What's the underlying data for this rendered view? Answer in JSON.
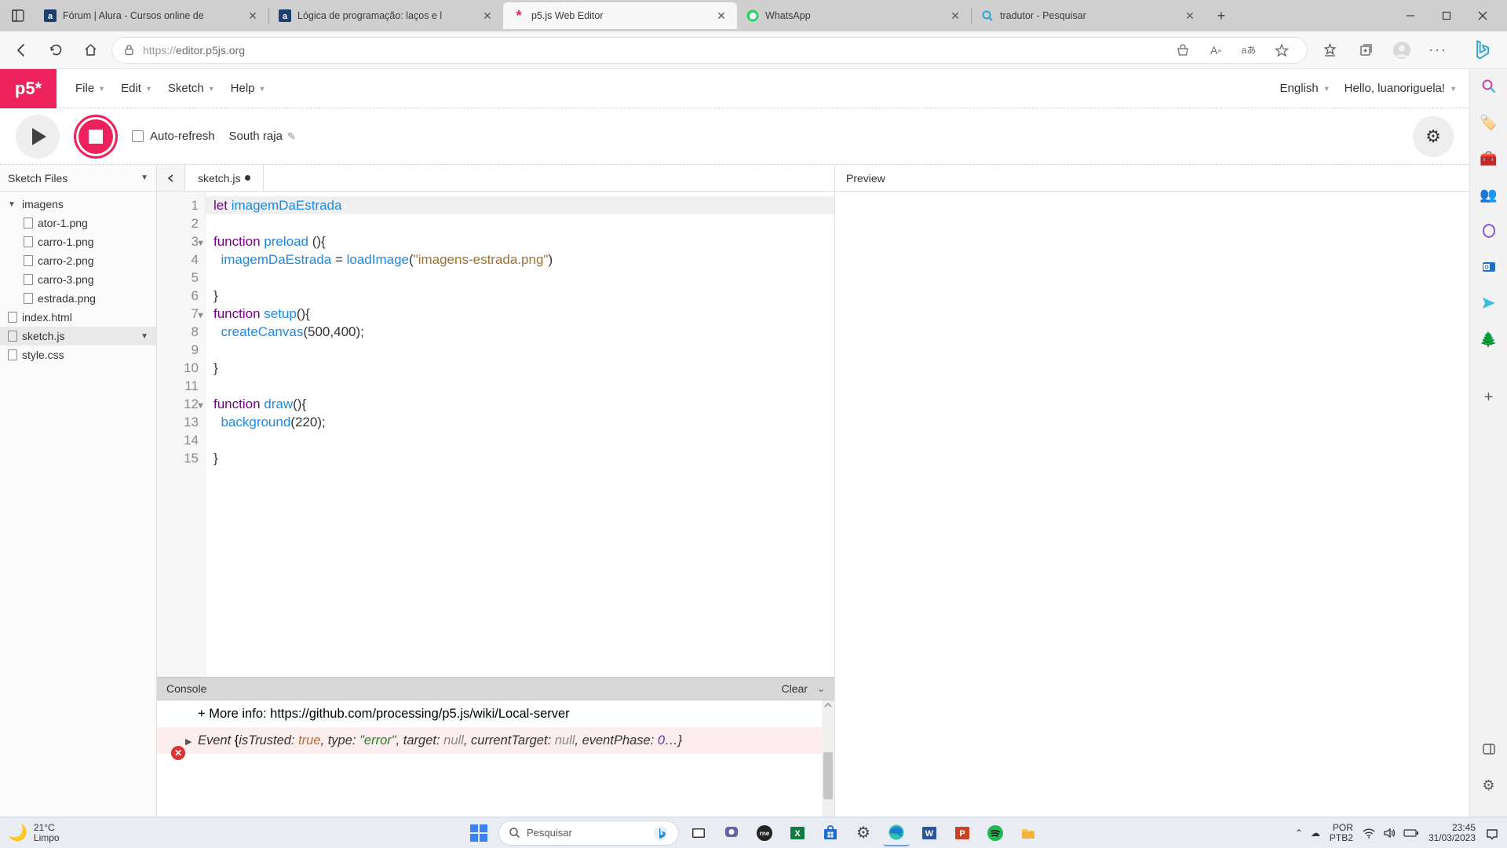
{
  "browser": {
    "tabs": [
      {
        "title": "Fórum | Alura - Cursos online de",
        "favicon": "a"
      },
      {
        "title": "Lógica de programação: laços e l",
        "favicon": "a"
      },
      {
        "title": "p5.js Web Editor",
        "favicon": "*",
        "active": true
      },
      {
        "title": "WhatsApp",
        "favicon": "wa"
      },
      {
        "title": "tradutor - Pesquisar",
        "favicon": "bing"
      }
    ],
    "url_proto": "https://",
    "url_host": "editor.p5js.org"
  },
  "menubar": {
    "logo": "p5*",
    "items": [
      "File",
      "Edit",
      "Sketch",
      "Help"
    ],
    "language": "English",
    "greeting": "Hello, luanoriguela!"
  },
  "toolbar": {
    "auto_refresh": "Auto-refresh",
    "sketch_name": "South raja"
  },
  "files": {
    "header": "Sketch Files",
    "folder": "imagens",
    "items": [
      "ator-1.png",
      "carro-1.png",
      "carro-2.png",
      "carro-3.png",
      "estrada.png"
    ],
    "root_items": [
      "index.html",
      "sketch.js",
      "style.css"
    ],
    "active": "sketch.js"
  },
  "editor": {
    "tab": "sketch.js",
    "lines": [
      {
        "n": 1,
        "hl": true,
        "seg": [
          [
            "kw",
            "let "
          ],
          [
            "var2",
            "imagemDaEstrada"
          ]
        ]
      },
      {
        "n": 2,
        "seg": []
      },
      {
        "n": 3,
        "fold": true,
        "seg": [
          [
            "kw",
            "function "
          ],
          [
            "fn",
            "preload"
          ],
          [
            "",
            " (){"
          ]
        ]
      },
      {
        "n": 4,
        "seg": [
          [
            "",
            "  "
          ],
          [
            "var2",
            "imagemDaEstrada"
          ],
          [
            "",
            " = "
          ],
          [
            "fn",
            "loadImage"
          ],
          [
            "",
            "("
          ],
          [
            "str",
            "\"imagens-estrada.png\""
          ],
          [
            "",
            ")"
          ]
        ]
      },
      {
        "n": 5,
        "seg": []
      },
      {
        "n": 6,
        "seg": [
          [
            "",
            "}"
          ]
        ]
      },
      {
        "n": 7,
        "fold": true,
        "seg": [
          [
            "kw",
            "function "
          ],
          [
            "fn",
            "setup"
          ],
          [
            "",
            "(){"
          ]
        ]
      },
      {
        "n": 8,
        "seg": [
          [
            "",
            "  "
          ],
          [
            "fn",
            "createCanvas"
          ],
          [
            "",
            "("
          ],
          [
            "num",
            "500"
          ],
          [
            "",
            ","
          ],
          [
            "num",
            "400"
          ],
          [
            "",
            ");"
          ]
        ]
      },
      {
        "n": 9,
        "seg": []
      },
      {
        "n": 10,
        "seg": [
          [
            "",
            "}"
          ]
        ]
      },
      {
        "n": 11,
        "seg": []
      },
      {
        "n": 12,
        "fold": true,
        "seg": [
          [
            "kw",
            "function "
          ],
          [
            "fn",
            "draw"
          ],
          [
            "",
            "(){"
          ]
        ]
      },
      {
        "n": 13,
        "seg": [
          [
            "",
            "  "
          ],
          [
            "fn",
            "background"
          ],
          [
            "",
            "("
          ],
          [
            "num",
            "220"
          ],
          [
            "",
            ");"
          ]
        ]
      },
      {
        "n": 14,
        "seg": []
      },
      {
        "n": 15,
        "seg": [
          [
            "",
            "}"
          ]
        ]
      }
    ]
  },
  "console": {
    "title": "Console",
    "clear": "Clear",
    "info_line": "+ More info: https://github.com/processing/p5.js/wiki/Local-server",
    "event_prefix": "Event ",
    "evt": {
      "isTrusted_k": "isTrusted: ",
      "isTrusted_v": "true",
      "type_k": ", type: ",
      "type_v": "\"error\"",
      "target_k": ", target: ",
      "target_v": "null",
      "currentTarget_k": ", currentTarget: ",
      "currentTarget_v": "null",
      "eventPhase_k": ", eventPhase: ",
      "eventPhase_v": "0",
      "tail": "…}"
    }
  },
  "preview": {
    "title": "Preview"
  },
  "taskbar": {
    "temp": "21°C",
    "cond": "Limpo",
    "search_placeholder": "Pesquisar",
    "lang1": "POR",
    "lang2": "PTB2",
    "time": "23:45",
    "date": "31/03/2023"
  }
}
